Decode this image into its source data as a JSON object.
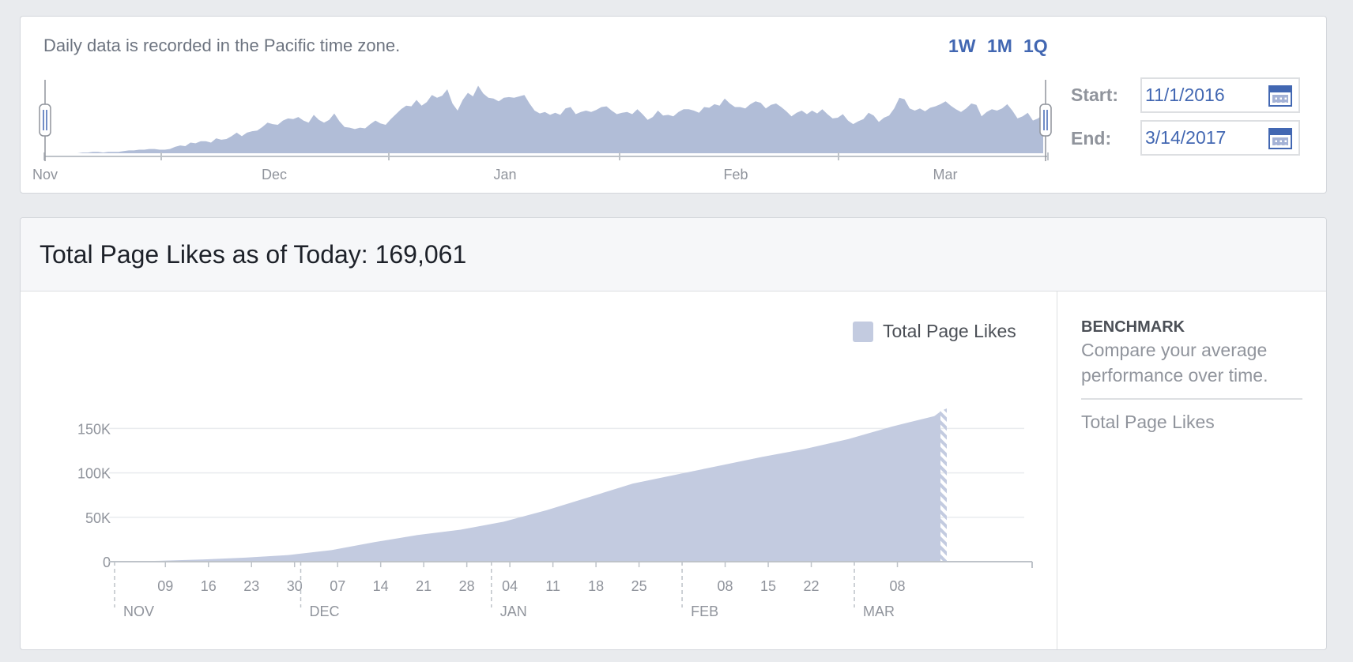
{
  "range_selector": {
    "note": "Daily data is recorded in the Pacific time zone.",
    "periods": [
      "1W",
      "1M",
      "1Q"
    ],
    "start_label": "Start:",
    "start_value": "11/1/2016",
    "end_label": "End:",
    "end_value": "3/14/2017",
    "months": [
      "Nov",
      "Dec",
      "Jan",
      "Feb",
      "Mar"
    ],
    "colors": {
      "accent": "#4267b2",
      "area": "#b1bdd7"
    },
    "icons": {
      "date_picker": "calendar-icon",
      "range_handle": "drag-handle-icon"
    }
  },
  "page_likes": {
    "title": "Total Page Likes as of Today: 169,061",
    "benchmark": {
      "title": "BENCHMARK",
      "description": "Compare your average performance over time.",
      "metric": "Total Page Likes"
    }
  },
  "chart_data": [
    {
      "type": "area",
      "description_of": "overview timeline (daily page activity, unlabeled y-axis)",
      "x_ticks": [
        "Nov",
        "Dec",
        "Jan",
        "Feb",
        "Mar"
      ],
      "y_relative_max": 1,
      "values": [
        0.0,
        0.01,
        0.01,
        0.02,
        0.02,
        0.01,
        0.02,
        0.02,
        0.02,
        0.03,
        0.04,
        0.04,
        0.05,
        0.05,
        0.06,
        0.06,
        0.05,
        0.05,
        0.06,
        0.09,
        0.11,
        0.1,
        0.15,
        0.14,
        0.17,
        0.17,
        0.15,
        0.21,
        0.19,
        0.2,
        0.24,
        0.29,
        0.24,
        0.29,
        0.31,
        0.32,
        0.37,
        0.43,
        0.41,
        0.4,
        0.46,
        0.49,
        0.48,
        0.51,
        0.46,
        0.43,
        0.54,
        0.47,
        0.43,
        0.47,
        0.56,
        0.45,
        0.37,
        0.36,
        0.34,
        0.36,
        0.35,
        0.41,
        0.46,
        0.42,
        0.4,
        0.48,
        0.55,
        0.62,
        0.67,
        0.66,
        0.75,
        0.67,
        0.72,
        0.82,
        0.78,
        0.81,
        0.9,
        0.7,
        0.6,
        0.75,
        0.85,
        0.8,
        0.95,
        0.84,
        0.78,
        0.77,
        0.73,
        0.78,
        0.79,
        0.78,
        0.8,
        0.82,
        0.7,
        0.6,
        0.56,
        0.58,
        0.54,
        0.57,
        0.54,
        0.63,
        0.65,
        0.55,
        0.58,
        0.6,
        0.58,
        0.61,
        0.65,
        0.66,
        0.6,
        0.55,
        0.57,
        0.58,
        0.55,
        0.62,
        0.55,
        0.47,
        0.51,
        0.6,
        0.53,
        0.54,
        0.52,
        0.58,
        0.62,
        0.62,
        0.6,
        0.57,
        0.65,
        0.64,
        0.69,
        0.67,
        0.77,
        0.7,
        0.65,
        0.65,
        0.63,
        0.69,
        0.73,
        0.71,
        0.63,
        0.68,
        0.7,
        0.65,
        0.59,
        0.52,
        0.57,
        0.6,
        0.55,
        0.6,
        0.56,
        0.62,
        0.55,
        0.49,
        0.5,
        0.55,
        0.46,
        0.41,
        0.45,
        0.48,
        0.57,
        0.53,
        0.44,
        0.5,
        0.53,
        0.63,
        0.78,
        0.76,
        0.63,
        0.6,
        0.63,
        0.59,
        0.64,
        0.66,
        0.69,
        0.73,
        0.67,
        0.62,
        0.58,
        0.63,
        0.7,
        0.68,
        0.52,
        0.58,
        0.62,
        0.6,
        0.63,
        0.69,
        0.6,
        0.49,
        0.52,
        0.57,
        0.46,
        0.49,
        0.55
      ]
    },
    {
      "type": "area",
      "title": "Total Page Likes",
      "series": [
        {
          "name": "Total Page Likes",
          "x_days_from_nov1": [
            0,
            7,
            14,
            21,
            28,
            35,
            42,
            49,
            56,
            63,
            70,
            77,
            84,
            91,
            98,
            105,
            112,
            119,
            126,
            133,
            134
          ],
          "values": [
            0,
            1000,
            2500,
            4500,
            7500,
            13000,
            22000,
            30000,
            36000,
            45000,
            58000,
            73000,
            88000,
            98000,
            108000,
            118000,
            127000,
            138000,
            152000,
            164000,
            169061
          ]
        }
      ],
      "ylim": [
        0,
        169061
      ],
      "y_ticks": [
        "0",
        "50K",
        "100K",
        "150K"
      ],
      "y_tick_values": [
        0,
        50000,
        100000,
        150000
      ],
      "x_tick_labels": [
        "09",
        "16",
        "23",
        "30",
        "07",
        "14",
        "21",
        "28",
        "04",
        "11",
        "18",
        "25",
        "08",
        "15",
        "22",
        "08"
      ],
      "x_tick_days": [
        8,
        15,
        22,
        29,
        36,
        43,
        50,
        57,
        64,
        71,
        78,
        85,
        99,
        106,
        113,
        127
      ],
      "month_labels": [
        "NOV",
        "DEC",
        "JAN",
        "FEB",
        "MAR"
      ],
      "month_start_days": [
        0,
        30,
        61,
        92,
        120
      ],
      "x_max_days": 134,
      "legend": "Total Page Likes",
      "legend_position": "top-right",
      "grid": true,
      "color": "#c3cbe0"
    }
  ]
}
